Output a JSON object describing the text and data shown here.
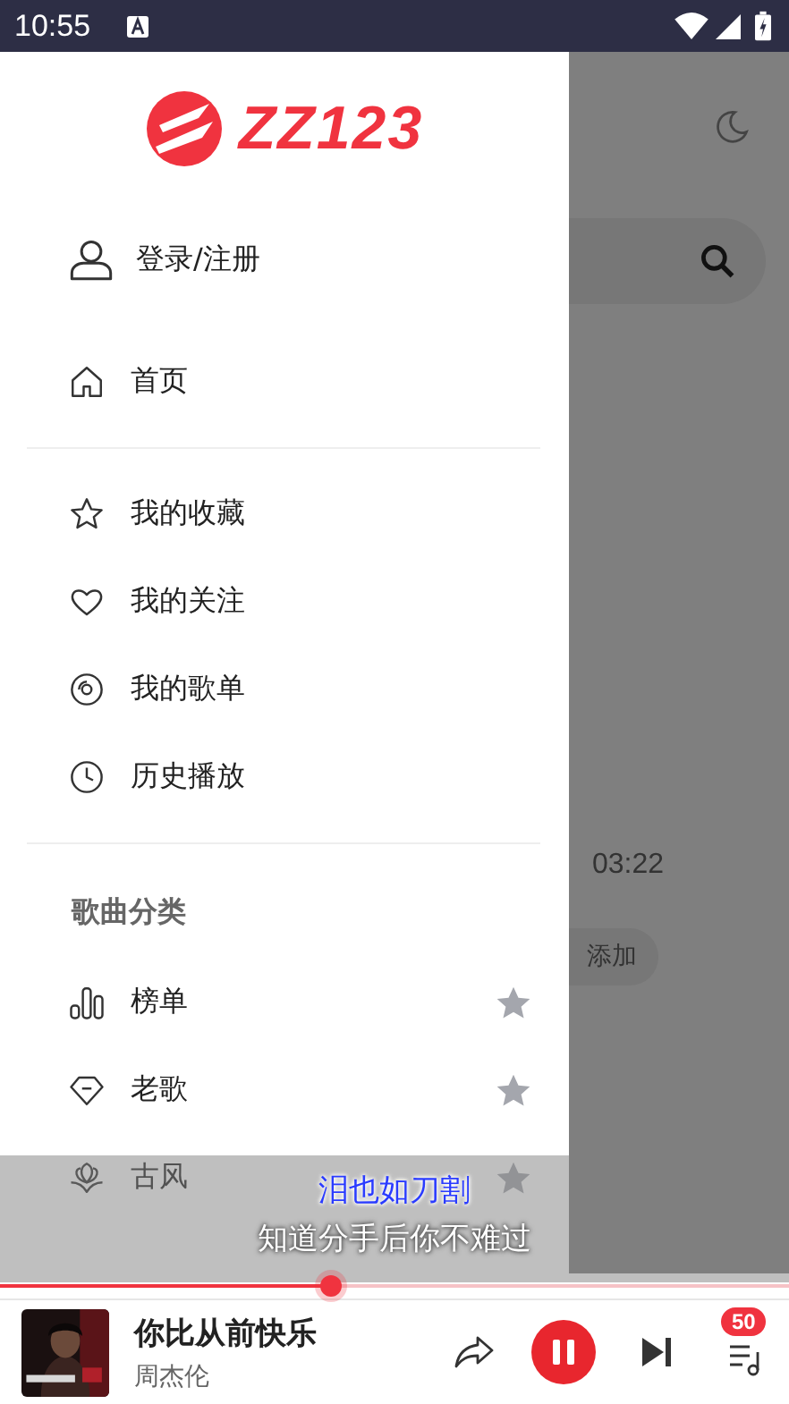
{
  "status_bar": {
    "time": "10:55"
  },
  "drawer": {
    "logo": "ZZ123",
    "account": {
      "label": "登录/注册"
    },
    "nav": [
      {
        "label": "首页",
        "kind": "home"
      }
    ],
    "library": [
      {
        "label": "我的收藏",
        "kind": "star"
      },
      {
        "label": "我的关注",
        "kind": "heart"
      },
      {
        "label": "我的歌单",
        "kind": "disc"
      },
      {
        "label": "历史播放",
        "kind": "clock"
      }
    ],
    "section_title": "歌曲分类",
    "categories": [
      {
        "label": "榜单",
        "kind": "chart"
      },
      {
        "label": "老歌",
        "kind": "gem"
      },
      {
        "label": "古风",
        "kind": "lotus"
      }
    ]
  },
  "background": {
    "time": "03:22",
    "add_button": "添加"
  },
  "lyrics": {
    "current": "泪也如刀割",
    "next": "知道分手后你不难过"
  },
  "player": {
    "level": 0.42,
    "title": "你比从前快乐",
    "artist": "周杰伦",
    "playing": true,
    "queue_count": "50"
  }
}
